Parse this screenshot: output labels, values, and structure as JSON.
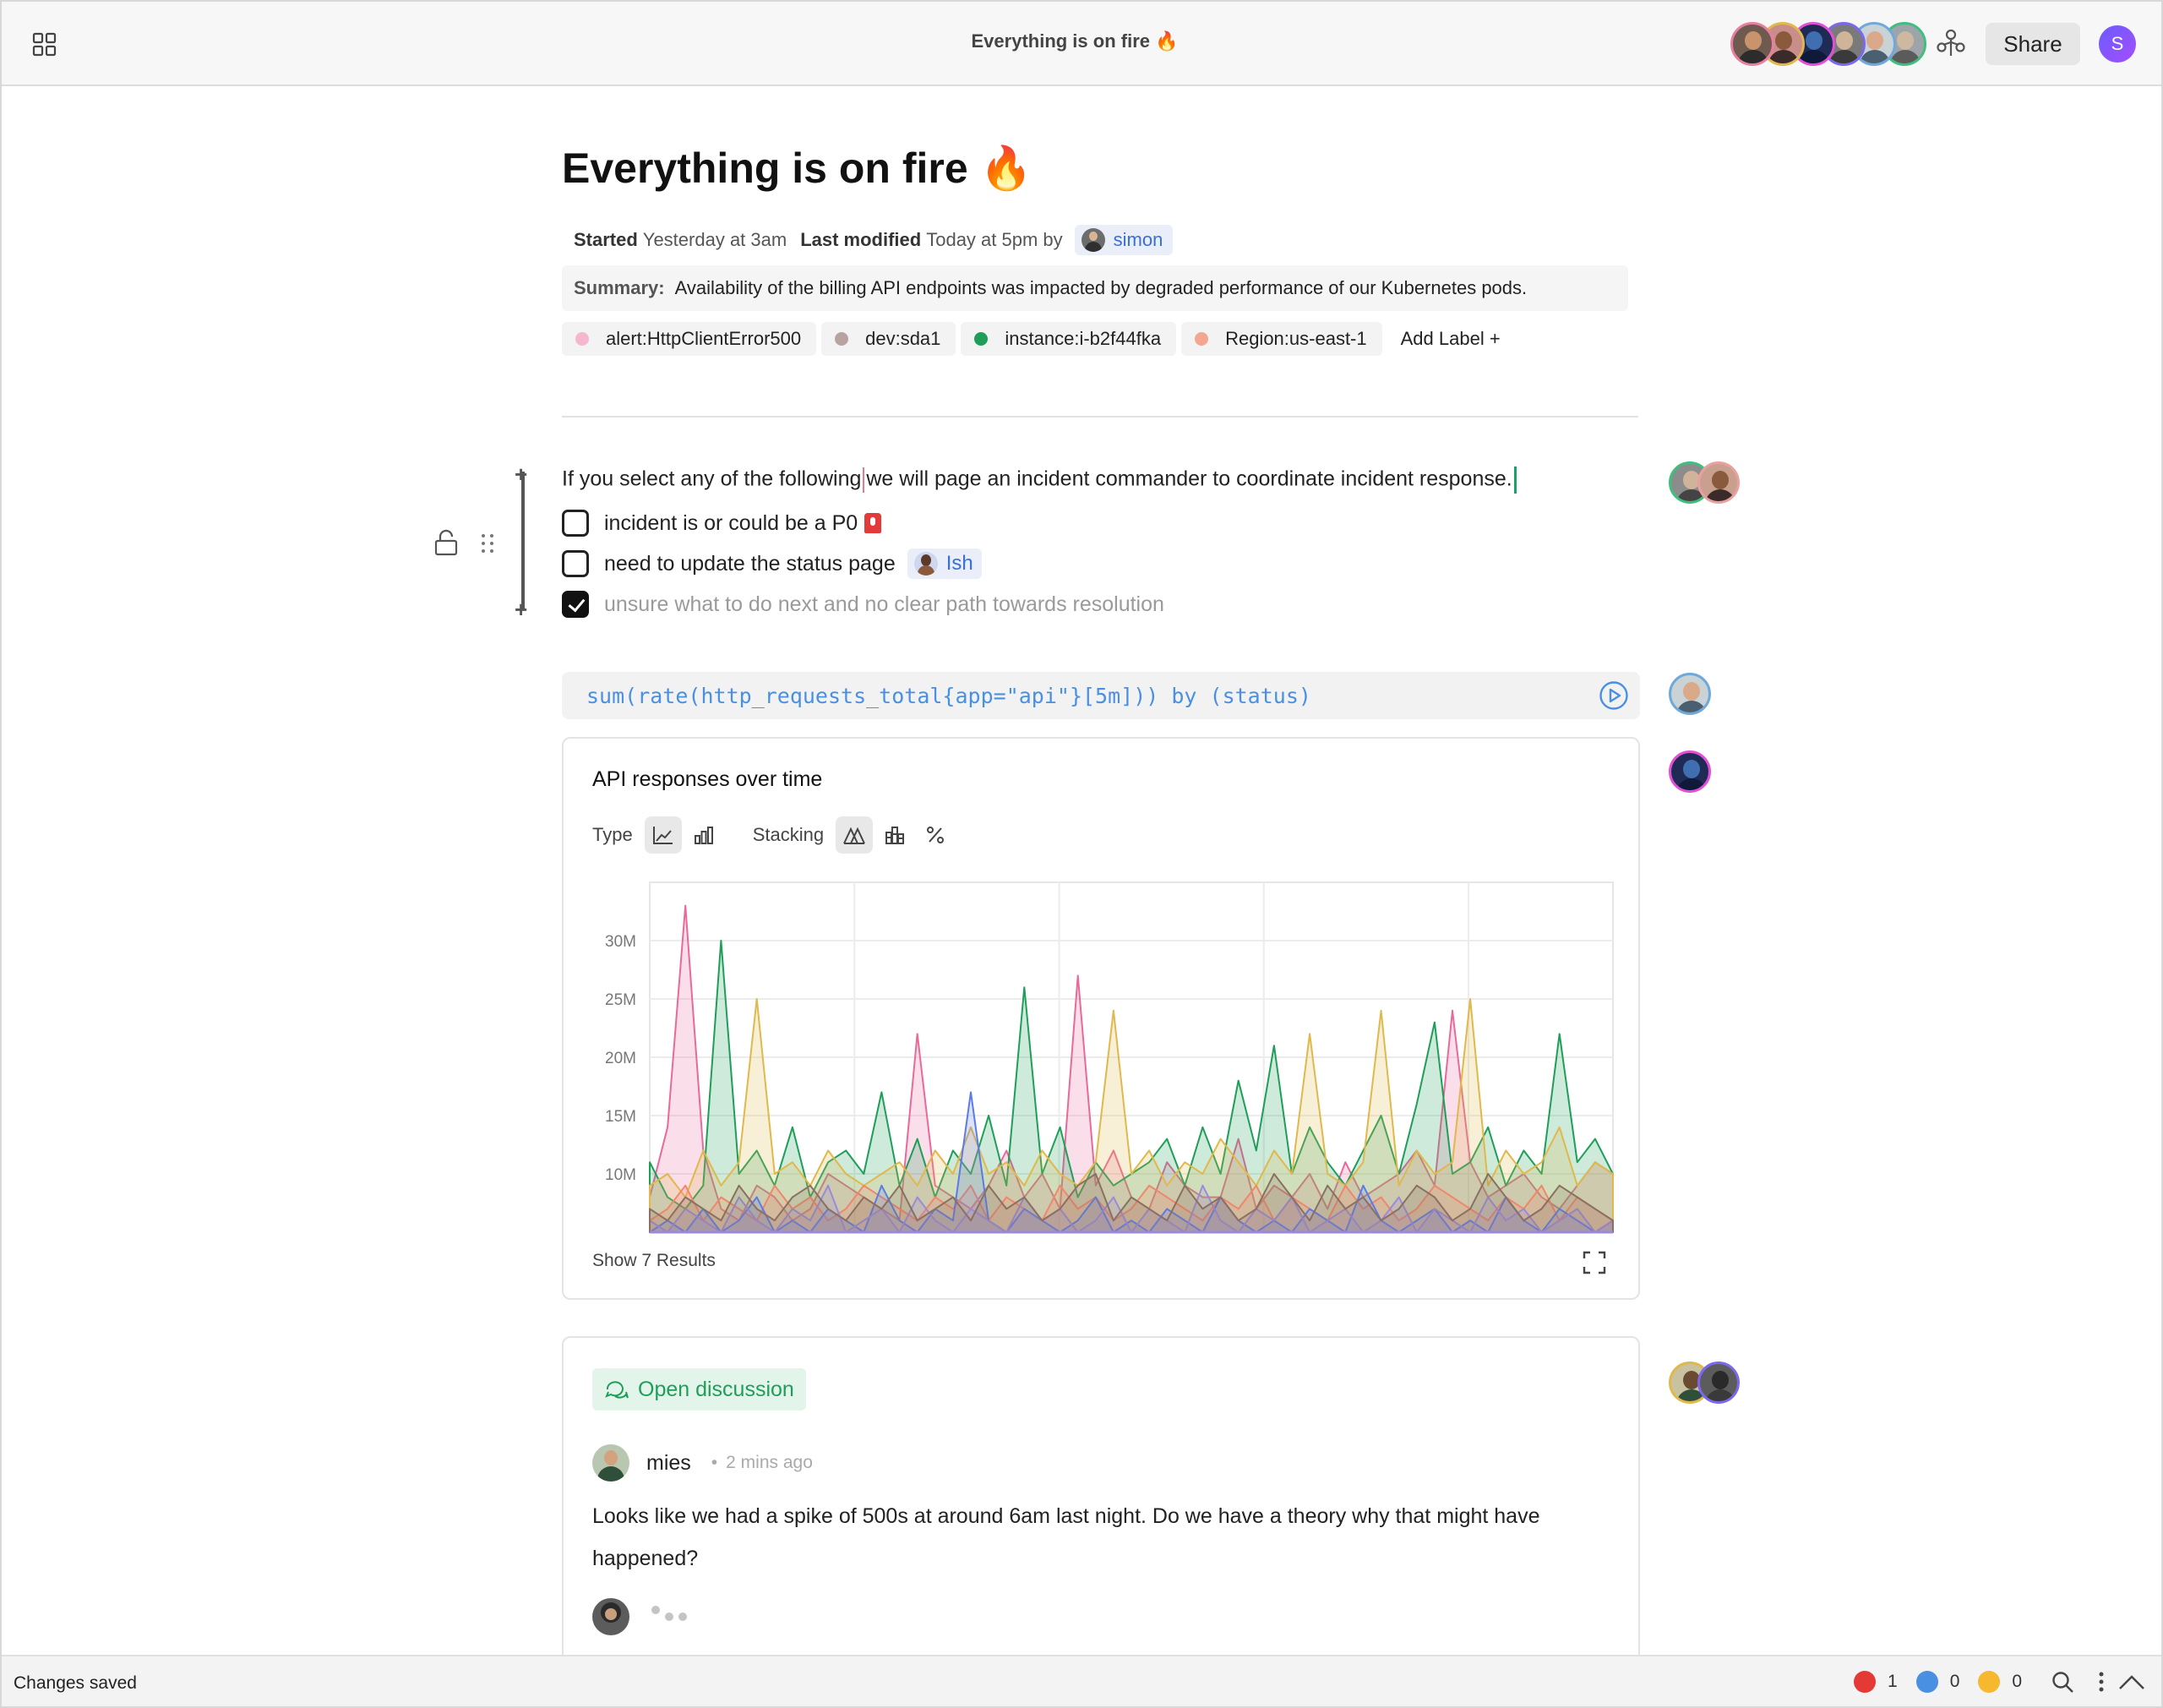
{
  "topbar": {
    "title": "Everything is on fire 🔥",
    "share_label": "Share",
    "user_initial": "S",
    "collaborators": [
      {
        "ring": "#e87fa0",
        "bg": "#6f5a4f",
        "skin": "#c9946c",
        "shirt": "#2c2c2c"
      },
      {
        "ring": "#e0b84b",
        "bg": "#c98e8a",
        "skin": "#8b5a3c",
        "shirt": "#3a2a2a"
      },
      {
        "ring": "#e24fd6",
        "bg": "#1f2b55",
        "skin": "#3f6fb0",
        "shirt": "#0f1a3a"
      },
      {
        "ring": "#7b68ee",
        "bg": "#7a7a7a",
        "skin": "#d0b49a",
        "shirt": "#3a3a3a"
      },
      {
        "ring": "#6fa8dc",
        "bg": "#c9d3d6",
        "skin": "#d9a98a",
        "shirt": "#4a6070"
      },
      {
        "ring": "#3fbf7f",
        "bg": "#9da5ab",
        "skin": "#cfb8a0",
        "shirt": "#5b5b5b"
      }
    ]
  },
  "doc": {
    "title": "Everything is on fire 🔥",
    "started_label": "Started",
    "started_value": "Yesterday at 3am",
    "modified_label": "Last modified",
    "modified_value": "Today at 5pm by",
    "modified_by": "simon",
    "summary_label": "Summary:",
    "summary_text": "Availability of the billing API endpoints was impacted by degraded performance of our Kubernetes pods.",
    "labels": [
      {
        "text": "alert:HttpClientError500",
        "color": "#f7b6cf"
      },
      {
        "text": "dev:sda1",
        "color": "#b8a3a0"
      },
      {
        "text": "instance:i-b2f44fka",
        "color": "#1f9e5a"
      },
      {
        "text": "Region:us-east-1",
        "color": "#f4a78f"
      }
    ],
    "add_label": "Add Label +"
  },
  "checklist": {
    "intro_a": "If you select any of the following",
    "intro_b": "we will page an incident commander to coordinate incident response.",
    "items": [
      {
        "text": "incident is or could be a P0",
        "checked": false
      },
      {
        "text": "need to update the status page",
        "checked": false,
        "mention": "Ish"
      },
      {
        "text": "unsure what to do next and no clear path towards resolution",
        "checked": true
      }
    ]
  },
  "query": {
    "text": "sum(rate(http_requests_total{app=\"api\"}[5m])) by (status)"
  },
  "chart": {
    "title": "API responses over time",
    "type_label": "Type",
    "stacking_label": "Stacking",
    "show_results": "Show 7 Results"
  },
  "chart_data": {
    "type": "area",
    "title": "API responses over time",
    "xlabel": "",
    "ylabel": "",
    "ylim": [
      5000000,
      35000000
    ],
    "yticks": [
      "10M",
      "15M",
      "20M",
      "25M",
      "30M"
    ],
    "grid": true,
    "series": [
      {
        "color": "#e86a9a",
        "values": [
          8,
          14,
          33,
          12,
          7,
          6,
          9,
          8,
          6,
          7,
          10,
          9,
          8,
          7,
          6,
          22,
          9,
          8,
          7,
          9,
          12,
          8,
          10,
          7,
          27,
          9,
          12,
          8,
          7,
          11,
          9,
          8,
          8,
          13,
          7,
          9,
          8,
          10,
          7,
          11,
          8,
          9,
          10,
          12,
          9,
          24,
          11,
          8,
          9,
          10,
          8,
          7,
          9,
          11,
          10
        ]
      },
      {
        "color": "#1f9e5a",
        "values": [
          11,
          8,
          7,
          9,
          30,
          10,
          12,
          9,
          14,
          8,
          11,
          12,
          10,
          17,
          9,
          13,
          8,
          12,
          10,
          15,
          9,
          26,
          10,
          14,
          8,
          11,
          9,
          10,
          11,
          13,
          9,
          14,
          10,
          18,
          12,
          21,
          10,
          14,
          11,
          9,
          12,
          15,
          10,
          16,
          23,
          10,
          11,
          14,
          9,
          12,
          10,
          22,
          11,
          13,
          10
        ]
      },
      {
        "color": "#e0b84b",
        "values": [
          9,
          10,
          8,
          12,
          9,
          11,
          25,
          10,
          11,
          9,
          12,
          10,
          9,
          10,
          11,
          9,
          12,
          10,
          14,
          10,
          11,
          9,
          12,
          10,
          9,
          11,
          24,
          10,
          12,
          9,
          11,
          10,
          13,
          11,
          9,
          12,
          10,
          22,
          10,
          9,
          11,
          24,
          9,
          12,
          10,
          11,
          25,
          9,
          12,
          10,
          11,
          14,
          9,
          11,
          10
        ]
      },
      {
        "color": "#f0866a",
        "values": [
          6,
          7,
          9,
          6,
          8,
          7,
          6,
          9,
          7,
          8,
          6,
          7,
          9,
          8,
          7,
          6,
          8,
          7,
          9,
          6,
          8,
          7,
          6,
          9,
          7,
          8,
          6,
          7,
          9,
          8,
          7,
          6,
          8,
          7,
          9,
          6,
          8,
          7,
          6,
          9,
          7,
          8,
          6,
          7,
          9,
          8,
          7,
          6,
          8,
          7,
          9,
          6,
          8,
          7,
          6
        ]
      },
      {
        "color": "#5b7be8",
        "values": [
          5,
          6,
          5,
          7,
          5,
          6,
          8,
          5,
          6,
          5,
          7,
          6,
          5,
          9,
          6,
          5,
          7,
          6,
          17,
          6,
          5,
          7,
          6,
          5,
          6,
          8,
          5,
          6,
          5,
          7,
          6,
          5,
          8,
          6,
          5,
          6,
          5,
          7,
          6,
          5,
          9,
          6,
          5,
          6,
          7,
          5,
          6,
          5,
          8,
          6,
          5,
          7,
          6,
          5,
          6
        ]
      },
      {
        "color": "#9c8ad8",
        "values": [
          6,
          5,
          7,
          6,
          5,
          8,
          6,
          5,
          7,
          6,
          9,
          5,
          6,
          7,
          5,
          8,
          6,
          5,
          7,
          6,
          5,
          8,
          6,
          7,
          5,
          6,
          8,
          5,
          7,
          6,
          5,
          9,
          6,
          5,
          7,
          6,
          8,
          5,
          6,
          7,
          5,
          6,
          8,
          5,
          7,
          6,
          5,
          8,
          6,
          7,
          5,
          6,
          7,
          5,
          6
        ]
      },
      {
        "color": "#8a7060",
        "values": [
          7,
          6,
          8,
          7,
          6,
          9,
          7,
          6,
          8,
          9,
          7,
          6,
          8,
          7,
          9,
          6,
          7,
          8,
          6,
          9,
          7,
          8,
          6,
          7,
          9,
          10,
          6,
          8,
          7,
          6,
          9,
          7,
          8,
          6,
          7,
          10,
          8,
          6,
          9,
          7,
          8,
          6,
          7,
          9,
          8,
          6,
          7,
          10,
          8,
          6,
          7,
          9,
          8,
          7,
          6
        ]
      }
    ]
  },
  "discussion": {
    "badge": "Open discussion",
    "author": "mies",
    "time": "2 mins ago",
    "body": "Looks like we had a spike of 500s at around 6am last night. Do we have a theory why that might have happened?"
  },
  "status": {
    "text": "Changes saved",
    "errors": "1",
    "infos": "0",
    "warnings": "0",
    "error_color": "#e53935",
    "info_color": "#4a90e2",
    "warning_color": "#f5b82e"
  }
}
